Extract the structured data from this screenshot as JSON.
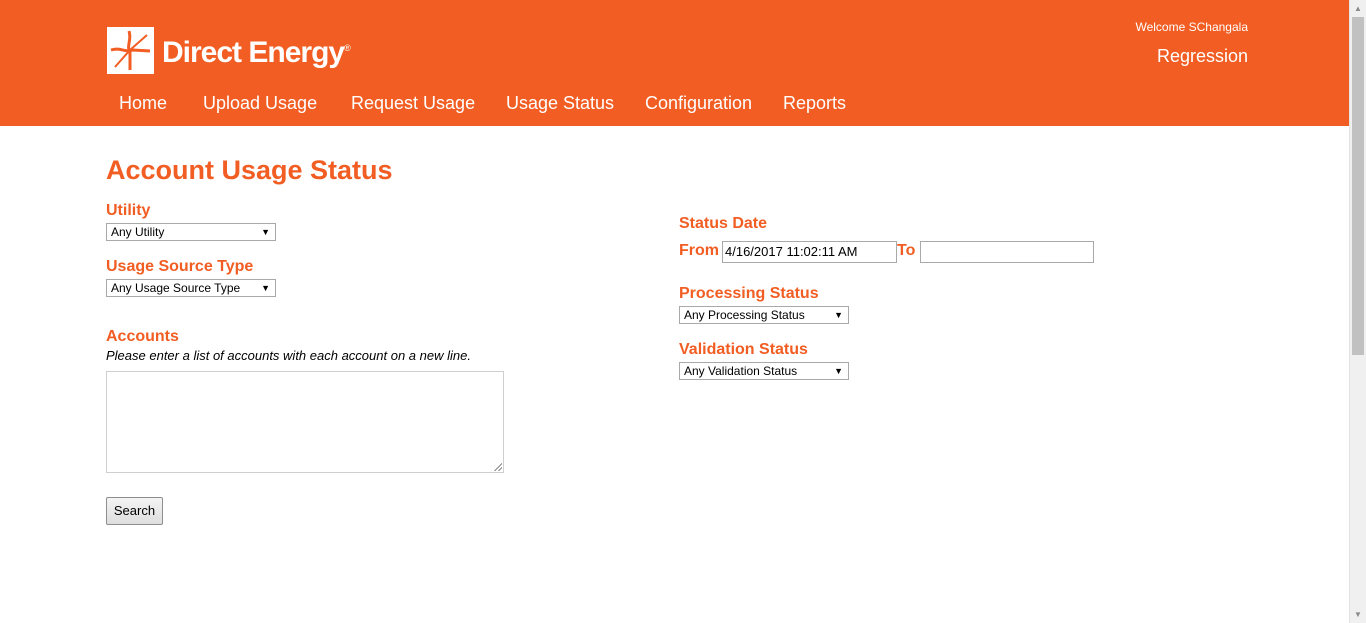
{
  "header": {
    "logo_text": "Direct Energy",
    "logo_trademark": "®",
    "welcome": "Welcome SChangala",
    "environment": "Regression",
    "nav": [
      "Home",
      "Upload Usage",
      "Request Usage",
      "Usage Status",
      "Configuration",
      "Reports"
    ]
  },
  "page": {
    "title": "Account Usage Status"
  },
  "filters": {
    "utility": {
      "label": "Utility",
      "value": "Any Utility"
    },
    "usage_source": {
      "label": "Usage Source Type",
      "value": "Any Usage Source Type"
    },
    "accounts": {
      "label": "Accounts",
      "hint": "Please enter a list of accounts with each account on a new line.",
      "value": ""
    },
    "search_label": "Search",
    "status_date": {
      "label": "Status Date",
      "from_label": "From",
      "from_value": "4/16/2017 11:02:11 AM",
      "to_label": "To",
      "to_value": ""
    },
    "processing": {
      "label": "Processing Status",
      "value": "Any Processing Status"
    },
    "validation": {
      "label": "Validation Status",
      "value": "Any Validation Status"
    }
  },
  "colors": {
    "brand": "#f15d22"
  }
}
